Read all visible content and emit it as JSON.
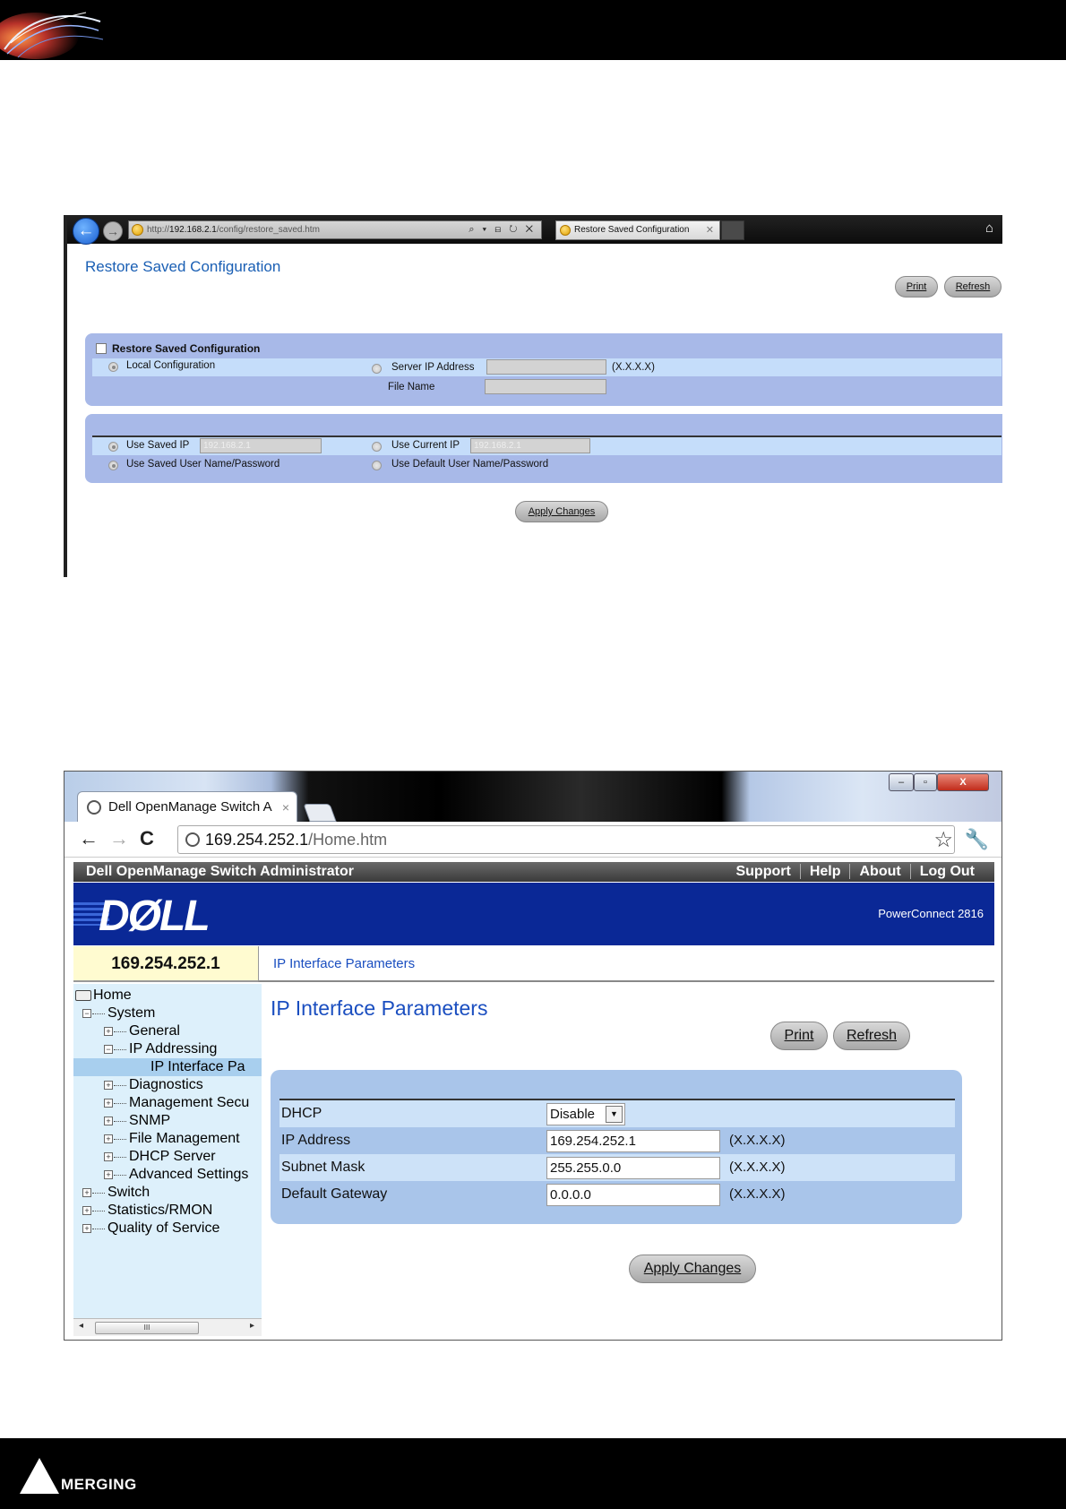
{
  "doc": {
    "brand_logo_text": "MERGING"
  },
  "shot1": {
    "address_prefix": "http://",
    "address_host": "192.168.2.1",
    "address_path": "/config/restore_saved.htm",
    "address_icons": "⌕ ▾ ⊟ ↻ ✕",
    "tab_title": "Restore Saved Configuration",
    "tab_close": "✕",
    "page_title": "Restore Saved Configuration",
    "print_label": "Print",
    "refresh_label": "Refresh",
    "section_title": "Restore Saved Configuration",
    "local_config_label": "Local Configuration",
    "server_ip_label": "Server IP Address",
    "server_ip_hint": "(X.X.X.X)",
    "file_name_label": "File Name",
    "use_saved_ip_label": "Use Saved IP",
    "use_saved_ip_value": "192.168.2.1",
    "use_current_ip_label": "Use Current IP",
    "use_current_ip_value": "192.168.2.1",
    "use_saved_user_label": "Use Saved User Name/Password",
    "use_default_user_label": "Use Default User Name/Password",
    "apply_label": "Apply Changes"
  },
  "shot2": {
    "win_close": "X",
    "tab_title": "Dell OpenManage Switch A",
    "tab_close": "×",
    "url_host": "169.254.252.1",
    "url_path": "/Home.htm",
    "app_title": "Dell OpenManage Switch Administrator",
    "links": [
      "Support",
      "Help",
      "About",
      "Log Out"
    ],
    "logo": "DØLL",
    "product": "PowerConnect 2816",
    "device_ip": "169.254.252.1",
    "breadcrumb": "IP Interface Parameters",
    "tree": [
      {
        "label": "Home",
        "level": 0,
        "kind": "root"
      },
      {
        "label": "System",
        "level": 1,
        "kind": "minus"
      },
      {
        "label": "General",
        "level": 2,
        "kind": "plus"
      },
      {
        "label": "IP Addressing",
        "level": 2,
        "kind": "minus"
      },
      {
        "label": "IP Interface Pa",
        "level": 3,
        "kind": "leaf",
        "selected": true
      },
      {
        "label": "Diagnostics",
        "level": 2,
        "kind": "plus"
      },
      {
        "label": "Management Secu",
        "level": 2,
        "kind": "plus"
      },
      {
        "label": "SNMP",
        "level": 2,
        "kind": "plus"
      },
      {
        "label": "File Management",
        "level": 2,
        "kind": "plus"
      },
      {
        "label": "DHCP Server",
        "level": 2,
        "kind": "plus"
      },
      {
        "label": "Advanced Settings",
        "level": 2,
        "kind": "plus"
      },
      {
        "label": "Switch",
        "level": 1,
        "kind": "plus"
      },
      {
        "label": "Statistics/RMON",
        "level": 1,
        "kind": "plus"
      },
      {
        "label": "Quality of Service",
        "level": 1,
        "kind": "plus"
      }
    ],
    "scroll_thumb": "III",
    "page_title": "IP Interface Parameters",
    "print_label": "Print",
    "refresh_label": "Refresh",
    "fields": {
      "dhcp_label": "DHCP",
      "dhcp_value": "Disable",
      "ip_label": "IP Address",
      "ip_value": "169.254.252.1",
      "ip_hint": "(X.X.X.X)",
      "mask_label": "Subnet Mask",
      "mask_value": "255.255.0.0",
      "mask_hint": "(X.X.X.X)",
      "gw_label": "Default Gateway",
      "gw_value": "0.0.0.0",
      "gw_hint": "(X.X.X.X)"
    },
    "apply_label": "Apply Changes"
  }
}
